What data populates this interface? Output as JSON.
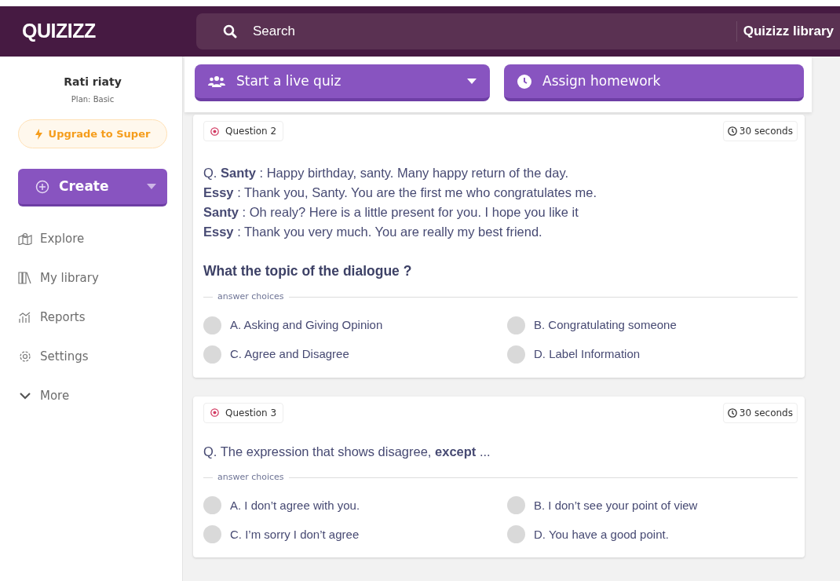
{
  "header": {
    "logo": "QUIZIZZ",
    "search": {
      "placeholder": "Search"
    },
    "library_link": "Quizizz library"
  },
  "sidebar": {
    "user_name": "Rati riaty",
    "plan": "Plan: Basic",
    "upgrade_button": "Upgrade to Super",
    "create_button": "Create",
    "items": [
      {
        "label": "Explore"
      },
      {
        "label": "My library"
      },
      {
        "label": "Reports"
      },
      {
        "label": "Settings"
      },
      {
        "label": "More"
      }
    ]
  },
  "actions": [
    {
      "label": "Start a live quiz",
      "dropdown": true
    },
    {
      "label": "Assign homework",
      "dropdown": false
    }
  ],
  "questions": [
    {
      "number": "Question 2",
      "time": "30 seconds",
      "lines": [
        {
          "kind": "text",
          "text": "Q. **Santy** : Happy birthday, santy. Many happy return of the day."
        },
        {
          "kind": "text",
          "text": "**Essy** : Thank you, Santy. You are the first me who congratulates me."
        },
        {
          "kind": "text",
          "text": "**Santy** : Oh realy? Here is a little present for you. I hope you like it"
        },
        {
          "kind": "text",
          "text": "**Essy** : Thank you very much. You are really my best friend."
        },
        {
          "kind": "prompt",
          "text": "What the topic of the dialogue ?"
        }
      ],
      "choices_label": "answer choices",
      "choices": [
        {
          "text": "A. Asking and Giving Opinion",
          "selected": false
        },
        {
          "text": "B. Congratulating someone",
          "selected": false
        },
        {
          "text": "C. Agree and Disagree",
          "selected": false
        },
        {
          "text": "D. Label Information",
          "selected": false
        }
      ]
    },
    {
      "number": "Question 3",
      "time": "30 seconds",
      "lines": [
        {
          "kind": "text",
          "text": "Q. The expression that shows disagree, **except** ..."
        }
      ],
      "choices_label": "answer choices",
      "choices": [
        {
          "text": "A. I don’t agree with you.",
          "selected": false
        },
        {
          "text": "B. I don’t see your point of view",
          "selected": false
        },
        {
          "text": "C. I’m sorry I don’t agree",
          "selected": false
        },
        {
          "text": "D. You have a good point.",
          "selected": false
        }
      ]
    }
  ]
}
